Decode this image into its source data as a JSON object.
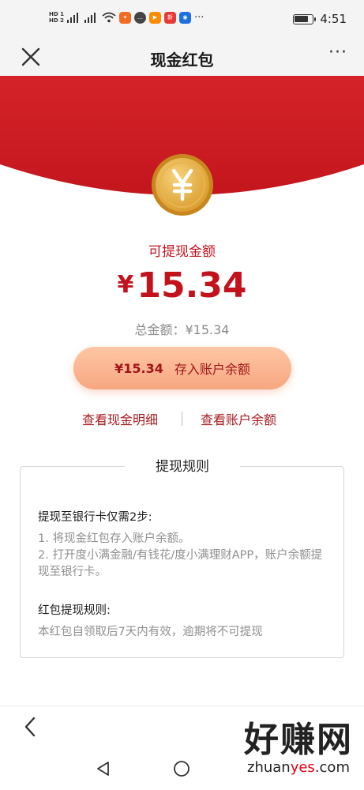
{
  "status_bar": {
    "hd1": "HD 1",
    "hd2": "HD 2",
    "network": "4G",
    "time": "4:51"
  },
  "nav": {
    "title": "现金红包",
    "more": "···"
  },
  "balance": {
    "label": "可提现金额",
    "currency_symbol": "¥",
    "amount": "15.34",
    "total_label": "总金额：¥15.34"
  },
  "deposit_button": {
    "amount": "¥15.34",
    "label": "存入账户余额"
  },
  "links": {
    "cash_detail": "查看现金明细",
    "account_balance": "查看账户余额"
  },
  "rules": {
    "title": "提现规则",
    "section1_heading": "提现至银行卡仅需2步:",
    "step1": "1. 将现金红包存入账户余额。",
    "step2": "2. 打开度小满金融/有钱花/度小满理财APP，账户余额提现至银行卡。",
    "section2_heading": "红包提现规则:",
    "section2_text": "本红包自领取后7天内有效，逾期将不可提现"
  },
  "watermark": {
    "brand": "好赚网",
    "url_prefix": "zhuan",
    "url_highlight": "yes",
    "url_suffix": ".com"
  },
  "colors": {
    "red": "#c4121d",
    "envelope_red": "#d11d22",
    "button_peach": "#f6a780"
  },
  "icons": {
    "coin": "yuan-coin-icon",
    "close": "close-icon",
    "back": "back-arrow-icon"
  }
}
